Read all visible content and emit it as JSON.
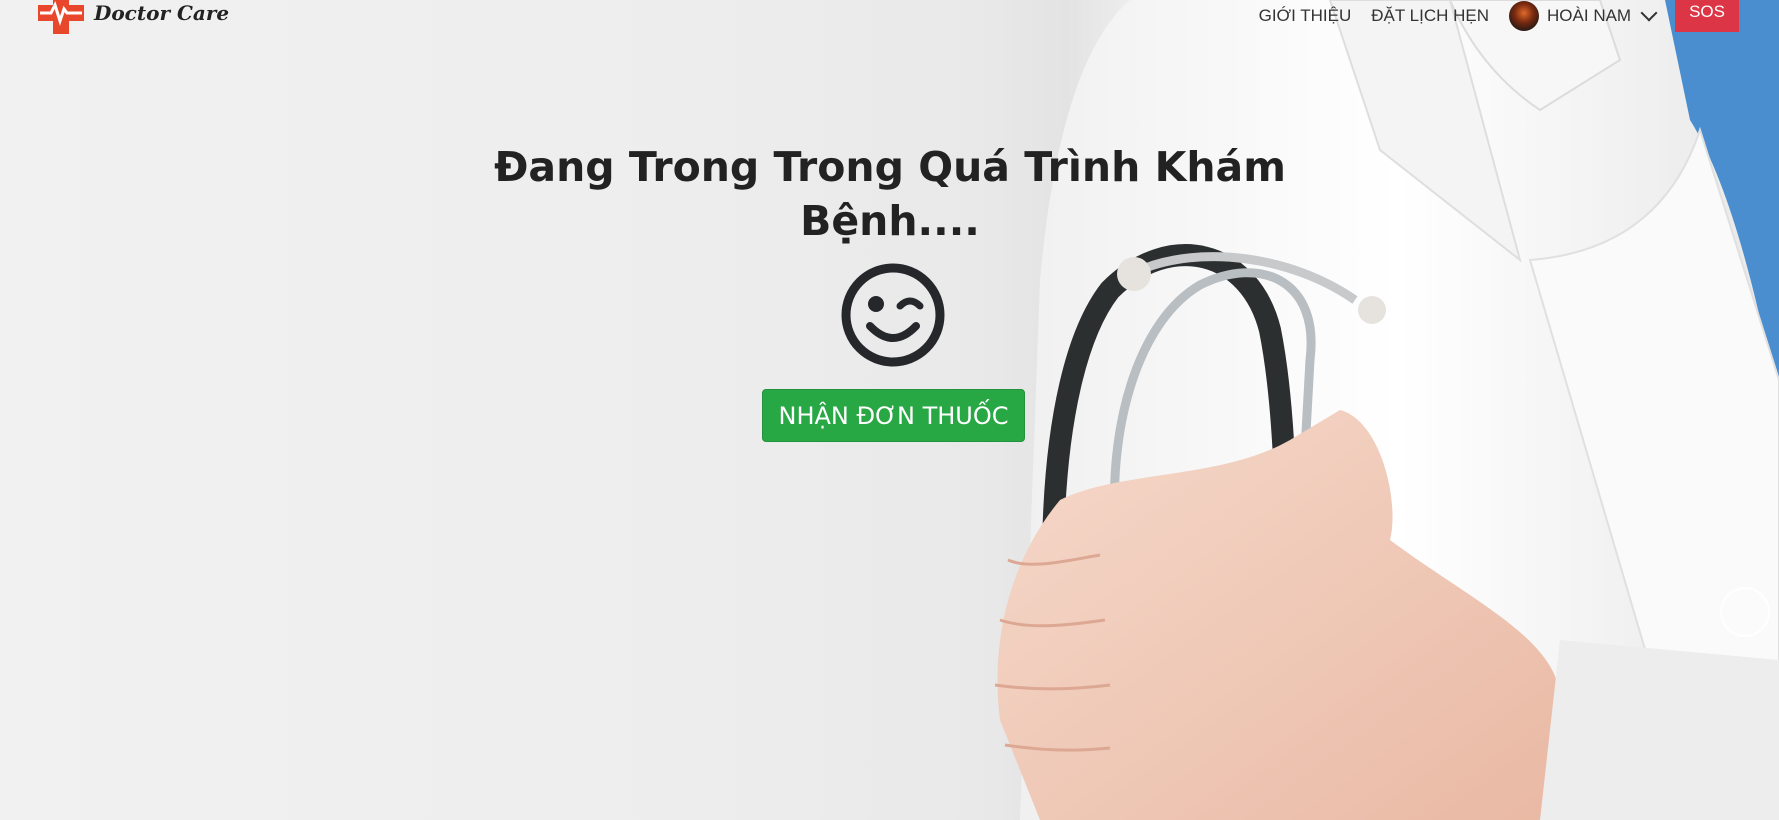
{
  "brand": {
    "name": "Doctor Care",
    "accent": "#e8472b"
  },
  "nav": {
    "links": [
      "GIỚI THIỆU",
      "ĐẶT LỊCH HẸN"
    ],
    "user_name": "HOÀI NAM",
    "sos_label": "SOS",
    "sos_color": "#dc3545"
  },
  "hero": {
    "title_line1": "Đang Trong Trong Quá Trình Khám",
    "title_line2": "Bệnh....",
    "icon": "wink-icon",
    "button_label": "NHẬN ĐƠN THUỐC",
    "button_color": "#28a745"
  }
}
